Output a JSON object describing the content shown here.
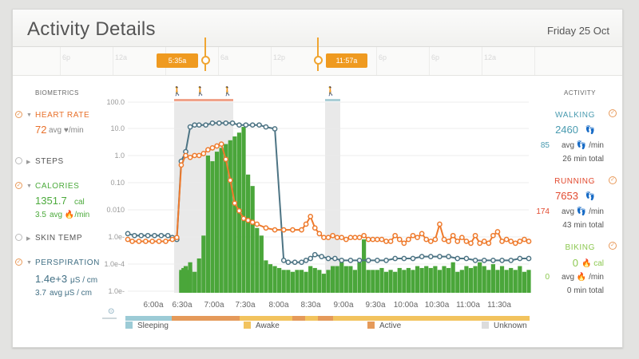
{
  "header": {
    "title": "Activity Details",
    "date": "Friday 25 Oct"
  },
  "timeline": {
    "ticks": [
      "6p",
      "12a",
      "6a",
      "6a",
      "12p",
      "6p",
      "6p",
      "12a"
    ],
    "start_label": "5:35a",
    "end_label": "11:57a"
  },
  "biometrics": {
    "heading": "BIOMETRICS",
    "heart_rate": {
      "label": "HEART RATE",
      "value": "72",
      "unit": "avg ♥/min"
    },
    "steps": {
      "label": "STEPS"
    },
    "calories": {
      "label": "CALORIES",
      "value": "1351.7",
      "unit": "cal",
      "avg": "3.5",
      "avg_unit": "avg 🔥/min"
    },
    "skin_temp": {
      "label": "SKIN TEMP"
    },
    "perspiration": {
      "label": "PERSPIRATION",
      "value": "1.4e+3",
      "unit": "μS / cm",
      "avg": "3.7",
      "avg_unit": "avg μS / cm"
    }
  },
  "activity": {
    "heading": "ACTIVITY",
    "walking": {
      "label": "WALKING",
      "steps": "2460",
      "avg": "85",
      "avg_unit": "avg 👣 /min",
      "total": "26 min total"
    },
    "running": {
      "label": "RUNNING",
      "steps": "7653",
      "avg": "174",
      "avg_unit": "avg 👣 /min",
      "total": "43 min total"
    },
    "biking": {
      "label": "BIKING",
      "cal": "0",
      "cal_unit": "🔥 cal",
      "avg": "0",
      "avg_unit": "avg 🔥 /min",
      "total": "0 min total"
    }
  },
  "legend": {
    "sleeping": "Sleeping",
    "awake": "Awake",
    "active": "Active",
    "unknown": "Unknown"
  },
  "colors": {
    "heart": "#e8702a",
    "calories": "#4caa3c",
    "perspiration": "#416f84",
    "walking": "#4a9bb0",
    "running": "#e2492e",
    "biking": "#8cc850",
    "bars": "#4aa63a",
    "line_orange": "#ee7a2c",
    "line_blue": "#4d7484",
    "sleeping": "#9ccbd6",
    "awake": "#f2c35e",
    "active": "#e59a5a",
    "unknown": "#dcdcdc"
  },
  "chart_data": {
    "type": "bar",
    "y_tick_labels": [
      "100.0",
      "10.0",
      "1.0",
      "0.10",
      "0.010",
      "1.0e-",
      "1.0e-4",
      "1.0e-"
    ],
    "x_tick_labels": [
      "6:00a",
      "6:30a",
      "7:00a",
      "7:30a",
      "8:00a",
      "8:30a",
      "9:00a",
      "9:30a",
      "10:00a",
      "10:30a",
      "11:00a",
      "11:30a"
    ],
    "bars": [
      [
        0.25,
        0.13
      ],
      [
        0.24,
        0.12
      ],
      [
        0.24,
        0.11
      ],
      [
        0.25,
        0.12
      ],
      [
        0.26,
        0.14
      ],
      [
        0.27,
        0.12
      ],
      [
        0.28,
        0.16
      ],
      [
        0.28,
        0.12
      ],
      [
        0.28,
        0.11
      ],
      [
        0.3,
        0.11
      ],
      [
        0.32,
        0.18
      ],
      [
        0.34,
        0.3
      ],
      [
        0.36,
        0.72
      ],
      [
        0.38,
        0.69
      ],
      [
        0.4,
        0.74
      ],
      [
        0.42,
        0.76
      ],
      [
        0.44,
        0.78
      ],
      [
        0.46,
        0.8
      ],
      [
        0.48,
        0.82
      ],
      [
        0.5,
        0.84
      ],
      [
        0.52,
        0.87
      ],
      [
        0.54,
        0.62
      ],
      [
        0.56,
        0.56
      ],
      [
        0.58,
        0.34
      ],
      [
        0.6,
        0.3
      ],
      [
        0.62,
        0.17
      ],
      [
        0.64,
        0.15
      ],
      [
        0.66,
        0.14
      ],
      [
        0.68,
        0.13
      ],
      [
        0.7,
        0.12
      ],
      [
        0.72,
        0.12
      ],
      [
        0.74,
        0.11
      ],
      [
        0.76,
        0.12
      ],
      [
        0.78,
        0.12
      ],
      [
        0.8,
        0.11
      ],
      [
        0.82,
        0.14
      ],
      [
        0.84,
        0.13
      ],
      [
        0.86,
        0.12
      ],
      [
        0.88,
        0.1
      ],
      [
        0.9,
        0.12
      ],
      [
        0.92,
        0.14
      ],
      [
        0.94,
        0.14
      ],
      [
        0.96,
        0.16
      ],
      [
        0.98,
        0.14
      ],
      [
        1.0,
        0.14
      ],
      [
        1.02,
        0.12
      ],
      [
        1.04,
        0.16
      ],
      [
        1.06,
        0.28
      ],
      [
        1.08,
        0.12
      ],
      [
        1.1,
        0.12
      ],
      [
        1.12,
        0.12
      ],
      [
        1.14,
        0.13
      ],
      [
        1.16,
        0.11
      ],
      [
        1.18,
        0.12
      ],
      [
        1.2,
        0.11
      ],
      [
        1.22,
        0.13
      ],
      [
        1.24,
        0.12
      ],
      [
        1.26,
        0.13
      ],
      [
        1.28,
        0.12
      ],
      [
        1.3,
        0.14
      ],
      [
        1.32,
        0.13
      ],
      [
        1.34,
        0.14
      ],
      [
        1.36,
        0.13
      ],
      [
        1.38,
        0.14
      ],
      [
        1.4,
        0.12
      ],
      [
        1.42,
        0.14
      ],
      [
        1.44,
        0.13
      ],
      [
        1.46,
        0.16
      ],
      [
        1.48,
        0.11
      ],
      [
        1.5,
        0.12
      ],
      [
        1.52,
        0.14
      ],
      [
        1.54,
        0.13
      ],
      [
        1.56,
        0.14
      ],
      [
        1.58,
        0.16
      ],
      [
        1.6,
        0.14
      ],
      [
        1.62,
        0.12
      ],
      [
        1.64,
        0.15
      ],
      [
        1.66,
        0.12
      ],
      [
        1.68,
        0.14
      ],
      [
        1.7,
        0.12
      ],
      [
        1.72,
        0.13
      ],
      [
        1.74,
        0.12
      ],
      [
        1.76,
        0.14
      ],
      [
        1.78,
        0.11
      ],
      [
        1.8,
        0.12
      ]
    ],
    "line_orange": [
      [
        0,
        0.28
      ],
      [
        0.02,
        0.27
      ],
      [
        0.05,
        0.27
      ],
      [
        0.08,
        0.27
      ],
      [
        0.11,
        0.27
      ],
      [
        0.14,
        0.27
      ],
      [
        0.17,
        0.27
      ],
      [
        0.2,
        0.28
      ],
      [
        0.22,
        0.29
      ],
      [
        0.24,
        0.67
      ],
      [
        0.26,
        0.72
      ],
      [
        0.28,
        0.71
      ],
      [
        0.3,
        0.72
      ],
      [
        0.32,
        0.72
      ],
      [
        0.34,
        0.73
      ],
      [
        0.36,
        0.75
      ],
      [
        0.38,
        0.76
      ],
      [
        0.4,
        0.77
      ],
      [
        0.42,
        0.78
      ],
      [
        0.44,
        0.7
      ],
      [
        0.46,
        0.59
      ],
      [
        0.48,
        0.47
      ],
      [
        0.5,
        0.43
      ],
      [
        0.52,
        0.39
      ],
      [
        0.54,
        0.38
      ],
      [
        0.56,
        0.37
      ],
      [
        0.58,
        0.36
      ],
      [
        0.62,
        0.34
      ],
      [
        0.66,
        0.33
      ],
      [
        0.7,
        0.33
      ],
      [
        0.74,
        0.33
      ],
      [
        0.78,
        0.33
      ],
      [
        0.8,
        0.36
      ],
      [
        0.82,
        0.4
      ],
      [
        0.84,
        0.34
      ],
      [
        0.86,
        0.31
      ],
      [
        0.88,
        0.29
      ],
      [
        0.9,
        0.29
      ],
      [
        0.92,
        0.3
      ],
      [
        0.94,
        0.29
      ],
      [
        0.96,
        0.29
      ],
      [
        0.98,
        0.28
      ],
      [
        1.0,
        0.29
      ],
      [
        1.02,
        0.29
      ],
      [
        1.04,
        0.29
      ],
      [
        1.06,
        0.3
      ],
      [
        1.08,
        0.28
      ],
      [
        1.1,
        0.28
      ],
      [
        1.12,
        0.28
      ],
      [
        1.14,
        0.28
      ],
      [
        1.16,
        0.27
      ],
      [
        1.18,
        0.27
      ],
      [
        1.2,
        0.3
      ],
      [
        1.22,
        0.28
      ],
      [
        1.24,
        0.26
      ],
      [
        1.26,
        0.28
      ],
      [
        1.28,
        0.3
      ],
      [
        1.3,
        0.29
      ],
      [
        1.32,
        0.31
      ],
      [
        1.34,
        0.28
      ],
      [
        1.36,
        0.27
      ],
      [
        1.38,
        0.28
      ],
      [
        1.4,
        0.36
      ],
      [
        1.42,
        0.28
      ],
      [
        1.44,
        0.27
      ],
      [
        1.46,
        0.3
      ],
      [
        1.48,
        0.27
      ],
      [
        1.5,
        0.29
      ],
      [
        1.52,
        0.27
      ],
      [
        1.54,
        0.26
      ],
      [
        1.56,
        0.3
      ],
      [
        1.58,
        0.26
      ],
      [
        1.6,
        0.27
      ],
      [
        1.62,
        0.26
      ],
      [
        1.64,
        0.3
      ],
      [
        1.66,
        0.32
      ],
      [
        1.68,
        0.27
      ],
      [
        1.7,
        0.28
      ],
      [
        1.72,
        0.27
      ],
      [
        1.74,
        0.26
      ],
      [
        1.76,
        0.27
      ],
      [
        1.78,
        0.28
      ],
      [
        1.8,
        0.27
      ]
    ],
    "line_blue": [
      [
        0,
        0.31
      ],
      [
        0.03,
        0.3
      ],
      [
        0.06,
        0.3
      ],
      [
        0.09,
        0.3
      ],
      [
        0.12,
        0.3
      ],
      [
        0.15,
        0.3
      ],
      [
        0.18,
        0.3
      ],
      [
        0.2,
        0.29
      ],
      [
        0.22,
        0.28
      ],
      [
        0.24,
        0.69
      ],
      [
        0.26,
        0.74
      ],
      [
        0.28,
        0.87
      ],
      [
        0.3,
        0.88
      ],
      [
        0.32,
        0.88
      ],
      [
        0.35,
        0.88
      ],
      [
        0.38,
        0.89
      ],
      [
        0.41,
        0.89
      ],
      [
        0.44,
        0.89
      ],
      [
        0.47,
        0.89
      ],
      [
        0.5,
        0.88
      ],
      [
        0.53,
        0.88
      ],
      [
        0.56,
        0.88
      ],
      [
        0.59,
        0.88
      ],
      [
        0.62,
        0.87
      ],
      [
        0.66,
        0.86
      ],
      [
        0.7,
        0.17
      ],
      [
        0.72,
        0.16
      ],
      [
        0.75,
        0.16
      ],
      [
        0.78,
        0.16
      ],
      [
        0.8,
        0.17
      ],
      [
        0.82,
        0.18
      ],
      [
        0.84,
        0.2
      ],
      [
        0.87,
        0.19
      ],
      [
        0.9,
        0.18
      ],
      [
        0.93,
        0.18
      ],
      [
        0.96,
        0.17
      ],
      [
        1.0,
        0.17
      ],
      [
        1.04,
        0.17
      ],
      [
        1.08,
        0.17
      ],
      [
        1.12,
        0.17
      ],
      [
        1.16,
        0.17
      ],
      [
        1.2,
        0.18
      ],
      [
        1.24,
        0.18
      ],
      [
        1.28,
        0.18
      ],
      [
        1.32,
        0.19
      ],
      [
        1.36,
        0.19
      ],
      [
        1.4,
        0.19
      ],
      [
        1.44,
        0.19
      ],
      [
        1.48,
        0.18
      ],
      [
        1.52,
        0.18
      ],
      [
        1.56,
        0.17
      ],
      [
        1.6,
        0.17
      ],
      [
        1.64,
        0.17
      ],
      [
        1.68,
        0.17
      ],
      [
        1.72,
        0.17
      ],
      [
        1.76,
        0.18
      ],
      [
        1.8,
        0.18
      ]
    ],
    "x_range": [
      0,
      1.8
    ],
    "y_range": [
      0,
      1
    ],
    "grid": true
  }
}
